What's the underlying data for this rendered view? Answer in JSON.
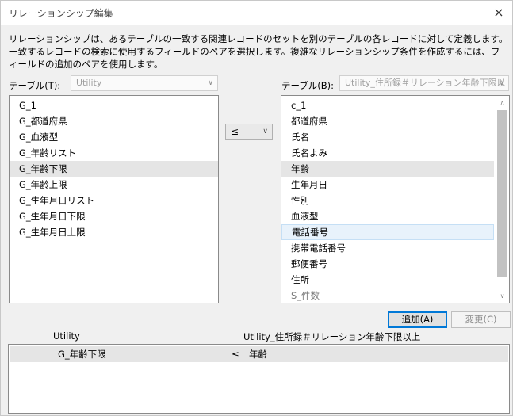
{
  "window": {
    "title": "リレーションシップ編集",
    "close_icon": "×"
  },
  "description": "リレーションシップは、あるテーブルの一致する関連レコードのセットを別のテーブルの各レコードに対して定義します。一致するレコードの検索に使用するフィールドのペアを選択します。複雑なリレーションシップ条件を作成するには、フィールドの追加のペアを使用します。",
  "left": {
    "table_label": "テーブル(T):",
    "table_value": "Utility",
    "fields": [
      "G_1",
      "G_都道府県",
      "G_血液型",
      "G_年齢リスト",
      "G_年齢下限",
      "G_年齢上限",
      "G_生年月日リスト",
      "G_生年月日下限",
      "G_生年月日上限"
    ],
    "selected_index": 4
  },
  "operator": {
    "value": "≤"
  },
  "right": {
    "table_label": "テーブル(B):",
    "table_value": "Utility_住所録＃リレーション年齢下限以上",
    "fields": [
      "c_1",
      "都道府県",
      "氏名",
      "氏名よみ",
      "年齢",
      "生年月日",
      "性別",
      "血液型",
      "電話番号",
      "携帯電話番号",
      "郵便番号",
      "住所",
      "S_件数"
    ],
    "selected_index": 4,
    "focus_index": 8
  },
  "buttons": {
    "add": "追加(A)",
    "change": "変更(C)"
  },
  "pairs": {
    "left_header": "Utility",
    "right_header": "Utility_住所録＃リレーション年齢下限以上",
    "rows": [
      {
        "left": "G_年齢下限",
        "op": "≤",
        "right": "年齢"
      }
    ]
  }
}
